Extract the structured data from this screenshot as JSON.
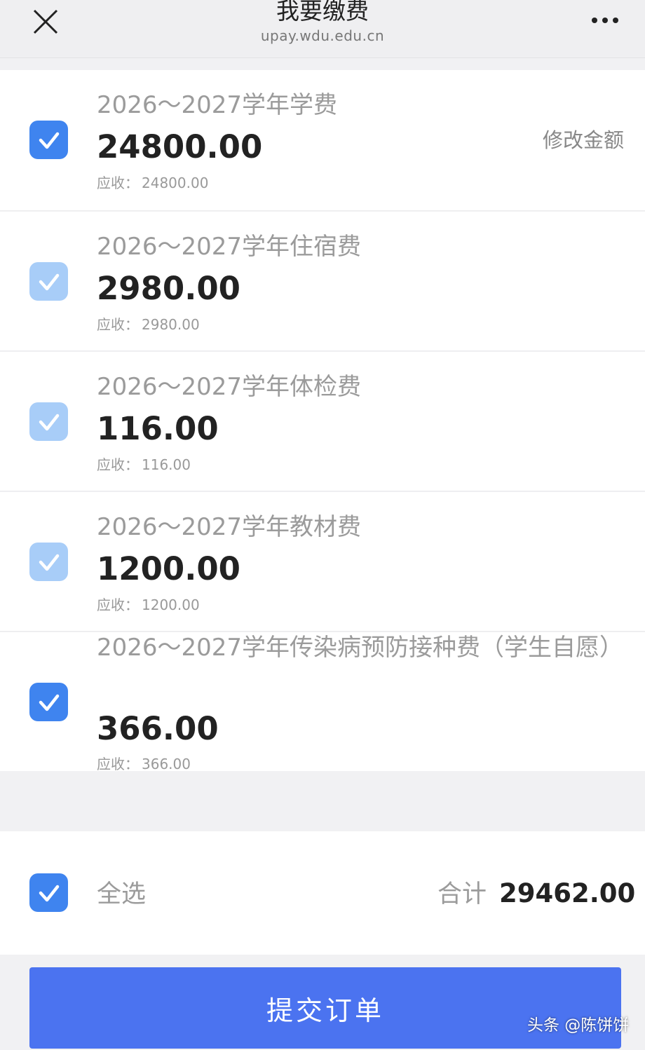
{
  "header": {
    "title": "我要缴费",
    "subtitle": "upay.wdu.edu.cn",
    "close_icon": "close-icon",
    "more_icon": "more-icon"
  },
  "fees": [
    {
      "name": "2026～2027学年学费",
      "amount": "24800.00",
      "due_label": "应收：",
      "due": "24800.00",
      "checked": true,
      "style": "active"
    },
    {
      "name": "2026～2027学年住宿费",
      "amount": "2980.00",
      "due_label": "应收：",
      "due": "2980.00",
      "checked": true,
      "style": "locked"
    },
    {
      "name": "2026～2027学年体检费",
      "amount": "116.00",
      "due_label": "应收：",
      "due": "116.00",
      "checked": true,
      "style": "locked"
    },
    {
      "name": "2026～2027学年教材费",
      "amount": "1200.00",
      "due_label": "应收：",
      "due": "1200.00",
      "checked": true,
      "style": "locked"
    },
    {
      "name": "2026～2027学年传染病预防接种费（学生自愿）",
      "amount": "366.00",
      "due_label": "应收：",
      "due": "366.00",
      "checked": true,
      "style": "active"
    }
  ],
  "edit_amount_label": "修改金额",
  "footer": {
    "select_all_label": "全选",
    "select_all_checked": true,
    "total_label": "合计",
    "total_amount": "29462.00"
  },
  "submit_label": "提交订单",
  "watermark": "头条 @陈饼饼",
  "colors": {
    "checkbox_active": "#3f84ef",
    "checkbox_locked": "#a8cdf8",
    "submit_button": "#4b73f0"
  }
}
